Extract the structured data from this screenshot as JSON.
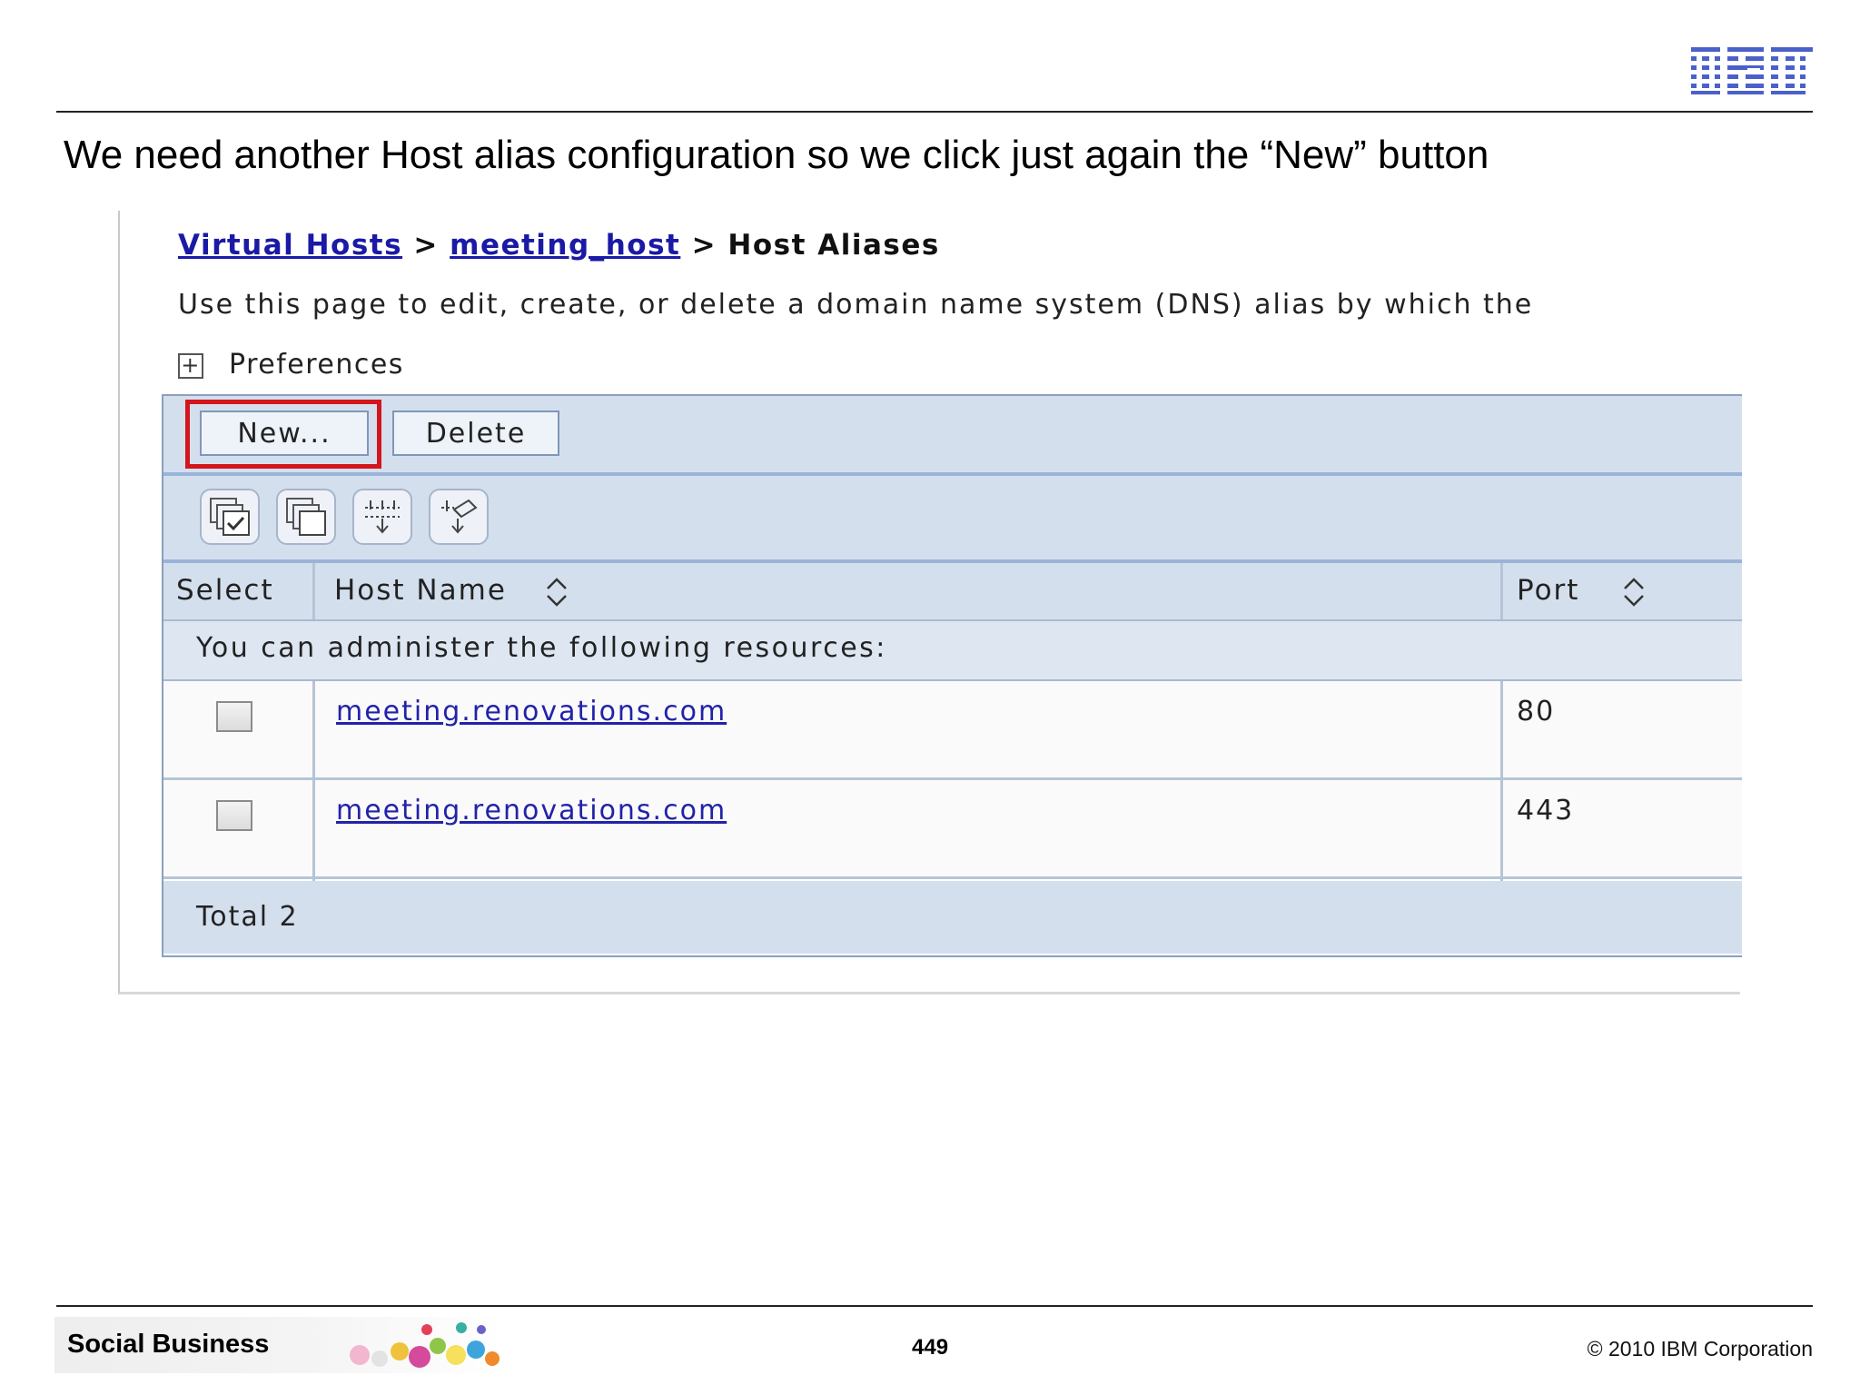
{
  "slide": {
    "logo_text": "IBM",
    "title": "We need another Host alias configuration so we click just again the “New” button",
    "footer_brand": "Social Business",
    "page_number": "449",
    "copyright": "© 2010 IBM Corporation"
  },
  "console": {
    "breadcrumb": {
      "link1": "Virtual Hosts",
      "sep1": ">",
      "link2": "meeting_host",
      "sep2": ">",
      "current": "Host Aliases"
    },
    "description": "Use this page to edit, create, or delete a domain name system (DNS) alias by which the",
    "preferences_label": "Preferences",
    "buttons": {
      "new_label": "New...",
      "delete_label": "Delete"
    },
    "toolbar_icons": [
      "select-all-icon",
      "deselect-all-icon",
      "show-filter-icon",
      "clear-filter-icon"
    ],
    "table": {
      "columns": [
        "Select",
        "Host Name",
        "Port"
      ],
      "resources_note": "You can administer the following resources:",
      "rows": [
        {
          "host": "meeting.renovations.com",
          "port": "80"
        },
        {
          "host": "meeting.renovations.com",
          "port": "443"
        }
      ],
      "total": "Total 2"
    },
    "colors": {
      "highlight": "#d4151b",
      "link": "#1a1aa6",
      "panel": "#d4dfee"
    }
  }
}
